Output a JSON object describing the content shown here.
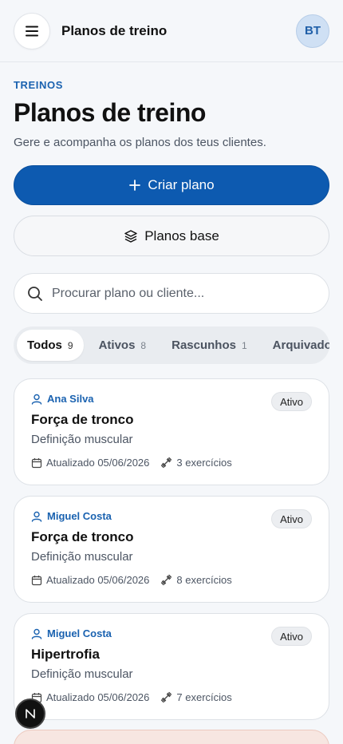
{
  "header": {
    "title": "Planos de treino",
    "avatar_initials": "BT"
  },
  "intro": {
    "eyebrow": "TREINOS",
    "title": "Planos de treino",
    "subtitle": "Gere e acompanha os planos dos teus clientes."
  },
  "actions": {
    "create_label": "Criar plano",
    "base_label": "Planos base"
  },
  "search": {
    "placeholder": "Procurar plano ou cliente...",
    "value": ""
  },
  "tabs": [
    {
      "label": "Todos",
      "count": "9",
      "active": true
    },
    {
      "label": "Ativos",
      "count": "8",
      "active": false
    },
    {
      "label": "Rascunhos",
      "count": "1",
      "active": false
    },
    {
      "label": "Arquivados",
      "count": "",
      "active": false
    }
  ],
  "plans": [
    {
      "client": "Ana Silva",
      "status": "Ativo",
      "name": "Força de tronco",
      "goal": "Definição muscular",
      "updated": "Atualizado 05/06/2026",
      "exercises": "3 exercícios"
    },
    {
      "client": "Miguel Costa",
      "status": "Ativo",
      "name": "Força de tronco",
      "goal": "Definição muscular",
      "updated": "Atualizado 05/06/2026",
      "exercises": "8 exercícios"
    },
    {
      "client": "Miguel Costa",
      "status": "Ativo",
      "name": "Hipertrofia",
      "goal": "Definição muscular",
      "updated": "Atualizado 05/06/2026",
      "exercises": "7 exercícios"
    }
  ],
  "colors": {
    "accent": "#0d5ab0",
    "link": "#1a62b0",
    "background": "#f5f7fa"
  },
  "icons": {
    "menu": "hamburger-icon",
    "create": "plus-icon",
    "base": "layers-icon",
    "search": "search-icon",
    "client": "user-icon",
    "updated": "calendar-icon",
    "exercises": "dumbbell-icon"
  }
}
